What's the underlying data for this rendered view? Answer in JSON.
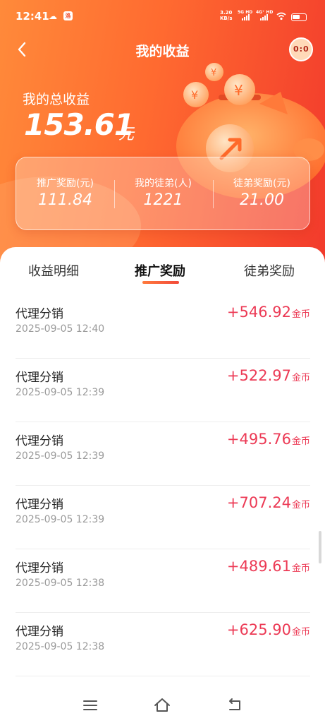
{
  "status_bar": {
    "time": "12:41",
    "speed_value": "3.20",
    "speed_unit": "KB/s",
    "net_5g": "5G HD",
    "net_4g": "4G⁺ HD",
    "app_badge": "洛"
  },
  "nav": {
    "title": "我的收益",
    "avatar_text": "0:0"
  },
  "summary": {
    "total_label": "我的总收益",
    "total_value": "153.61",
    "total_unit": "元",
    "stats": [
      {
        "label": "推广奖励(元)",
        "value": "111.84"
      },
      {
        "label": "我的徒弟(人)",
        "value": "1221"
      },
      {
        "label": "徒弟奖励(元)",
        "value": "21.00"
      }
    ]
  },
  "tabs": [
    {
      "label": "收益明细",
      "active": false
    },
    {
      "label": "推广奖励",
      "active": true
    },
    {
      "label": "徒弟奖励",
      "active": false
    }
  ],
  "records": [
    {
      "title": "代理分销",
      "time": "2025-09-05 12:40",
      "amount": "+546.92",
      "unit": "金币"
    },
    {
      "title": "代理分销",
      "time": "2025-09-05 12:39",
      "amount": "+522.97",
      "unit": "金币"
    },
    {
      "title": "代理分销",
      "time": "2025-09-05 12:39",
      "amount": "+495.76",
      "unit": "金币"
    },
    {
      "title": "代理分销",
      "time": "2025-09-05 12:39",
      "amount": "+707.24",
      "unit": "金币"
    },
    {
      "title": "代理分销",
      "time": "2025-09-05 12:38",
      "amount": "+489.61",
      "unit": "金币"
    },
    {
      "title": "代理分销",
      "time": "2025-09-05 12:38",
      "amount": "+625.90",
      "unit": "金币"
    }
  ],
  "colors": {
    "header_start": "#ff8a3a",
    "header_end": "#f23a2c",
    "amount": "#ec3a55"
  },
  "icons": {
    "back": "chevron-left-icon",
    "menu": "menu-icon",
    "home": "home-icon",
    "return": "back-arrow-icon"
  }
}
